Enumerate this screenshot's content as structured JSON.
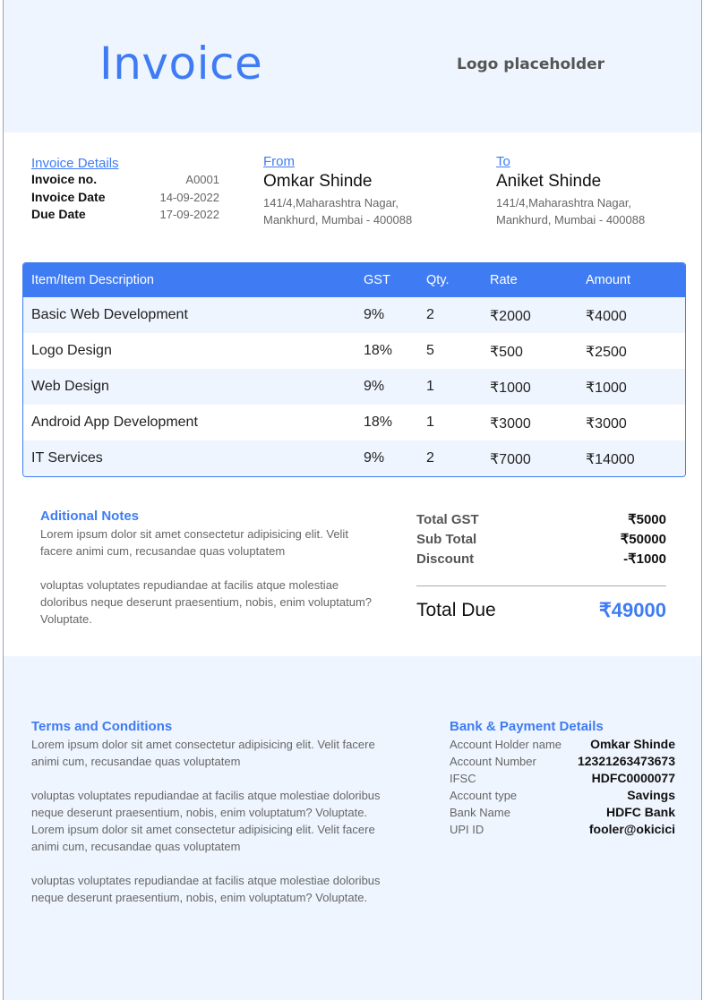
{
  "header": {
    "title": "Invoice",
    "logo": "Logo placeholder"
  },
  "invoice_details": {
    "heading": "Invoice Details",
    "rows": [
      {
        "label": "Invoice no.",
        "value": "A0001"
      },
      {
        "label": "Invoice Date",
        "value": "14-09-2022"
      },
      {
        "label": "Due Date",
        "value": "17-09-2022"
      }
    ]
  },
  "from": {
    "heading": "From",
    "name": "Omkar Shinde",
    "address_line1": "141/4,Maharashtra Nagar,",
    "address_line2": "Mankhurd, Mumbai - 400088"
  },
  "to": {
    "heading": "To",
    "name": "Aniket Shinde",
    "address_line1": "141/4,Maharashtra Nagar,",
    "address_line2": "Mankhurd, Mumbai - 400088"
  },
  "items_table": {
    "headers": [
      "Item/Item Description",
      "GST",
      "Qty.",
      "Rate",
      "Amount"
    ],
    "rows": [
      [
        "Basic Web Development",
        "9%",
        "2",
        "₹2000",
        "₹4000"
      ],
      [
        "Logo Design",
        "18%",
        "5",
        "₹500",
        "₹2500"
      ],
      [
        "Web Design",
        "9%",
        "1",
        "₹1000",
        "₹1000"
      ],
      [
        "Android App Development",
        "18%",
        "1",
        "₹3000",
        "₹3000"
      ],
      [
        "IT Services",
        "9%",
        "2",
        "₹7000",
        "₹14000"
      ]
    ]
  },
  "notes": {
    "heading": "Aditional Notes",
    "paragraphs": [
      "Lorem ipsum dolor sit amet consectetur adipisicing elit. Velit facere animi cum, recusandae quas voluptatem",
      "voluptas voluptates repudiandae at facilis atque molestiae doloribus neque deserunt praesentium, nobis, enim voluptatum? Voluptate."
    ]
  },
  "totals": {
    "rows": [
      {
        "label": "Total GST",
        "value": "₹5000"
      },
      {
        "label": "Sub Total",
        "value": "₹50000"
      },
      {
        "label": "Discount",
        "value": "-₹1000"
      }
    ],
    "due_label": "Total Due",
    "due_value": "₹49000"
  },
  "terms": {
    "heading": "Terms and Conditions",
    "paragraphs": [
      "Lorem ipsum dolor sit amet consectetur adipisicing elit. Velit facere animi cum, recusandae quas voluptatem",
      "voluptas voluptates repudiandae at facilis atque molestiae doloribus neque deserunt praesentium, nobis, enim voluptatum? Voluptate.\nLorem ipsum dolor sit amet consectetur adipisicing elit. Velit facere animi cum, recusandae quas voluptatem",
      "voluptas voluptates repudiandae at facilis atque molestiae doloribus neque deserunt praesentium, nobis, enim voluptatum? Voluptate."
    ]
  },
  "bank": {
    "heading": "Bank & Payment Details",
    "rows": [
      {
        "label": "Account Holder name",
        "value": "Omkar Shinde"
      },
      {
        "label": "Account Number",
        "value": "12321263473673"
      },
      {
        "label": "IFSC",
        "value": "HDFC0000077"
      },
      {
        "label": "Account type",
        "value": "Savings"
      },
      {
        "label": "Bank Name",
        "value": "HDFC Bank"
      },
      {
        "label": "UPI ID",
        "value": "fooler@okicici"
      }
    ]
  },
  "colors": {
    "accent": "#3f7cf3",
    "light_bg": "#eff5fe"
  }
}
